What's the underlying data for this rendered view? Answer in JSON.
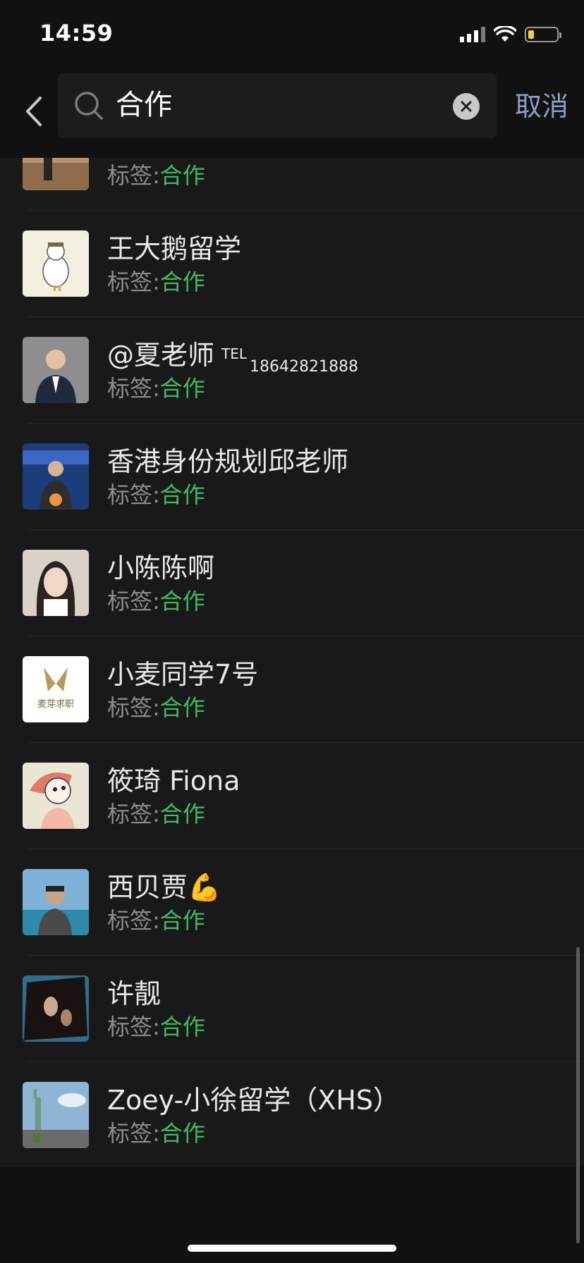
{
  "status_bar": {
    "time": "14:59"
  },
  "search": {
    "query": "合作",
    "cancel_label": "取消"
  },
  "tag_prefix": "标签:",
  "contacts": [
    {
      "name": "",
      "tag": "合作",
      "avatar": "desert-photo-avatar"
    },
    {
      "name": "王大鹅留学",
      "tag": "合作",
      "avatar": "cartoon-goose-avatar"
    },
    {
      "name": "@夏老师",
      "name_sup": "TEL",
      "name_suffix": "18642821888",
      "tag": "合作",
      "avatar": "man-in-suit-avatar"
    },
    {
      "name": "香港身份规划邱老师",
      "tag": "合作",
      "avatar": "studio-man-avatar"
    },
    {
      "name": "小陈陈啊",
      "tag": "合作",
      "avatar": "woman-selfie-avatar"
    },
    {
      "name": "小麦同学7号",
      "tag": "合作",
      "avatar": "maiya-logo-avatar",
      "logo_text": "麦芽求职"
    },
    {
      "name": "筱琦 Fiona",
      "tag": "合作",
      "avatar": "cartoon-girl-avatar"
    },
    {
      "name": "西贝贾💪",
      "tag": "合作",
      "avatar": "man-seaside-avatar"
    },
    {
      "name": "许靓",
      "tag": "合作",
      "avatar": "dark-photo-avatar"
    },
    {
      "name": "Zoey-小徐留学（XHS）",
      "tag": "合作",
      "avatar": "statue-of-liberty-avatar"
    }
  ],
  "colors": {
    "background": "#111111",
    "list_background": "#191919",
    "tag_green": "#3fbb63",
    "cancel_blue": "#8a9ec7",
    "battery_yellow": "#f4cf3a"
  }
}
